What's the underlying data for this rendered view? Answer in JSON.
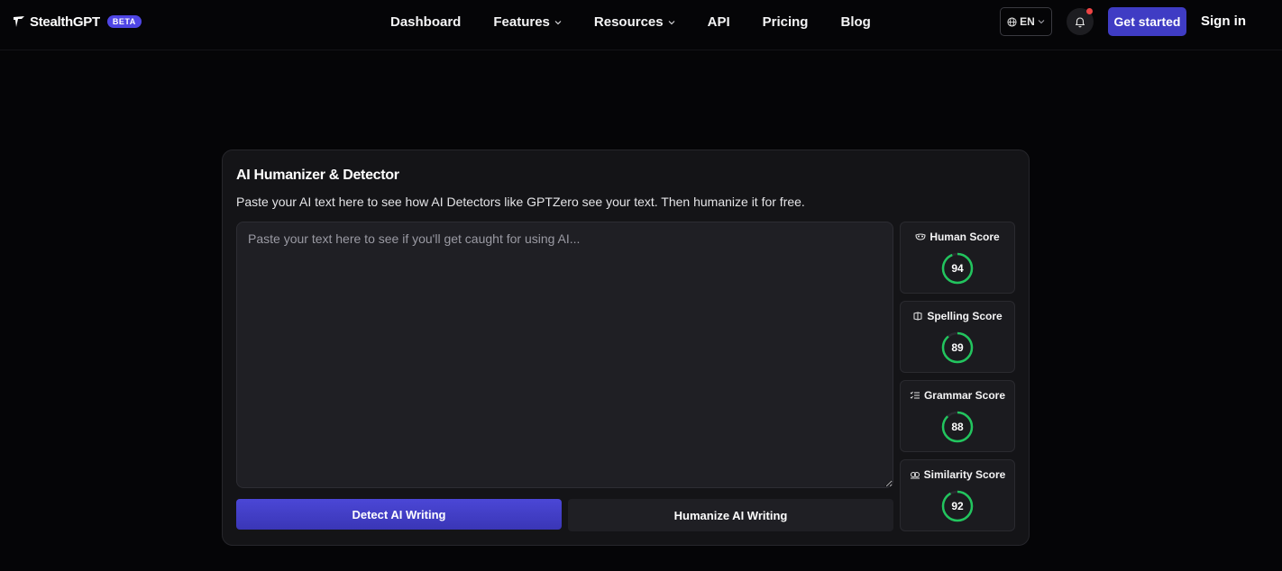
{
  "brand": {
    "name": "StealthGPT",
    "badge": "BETA"
  },
  "nav": {
    "links": [
      {
        "label": "Dashboard",
        "dropdown": false
      },
      {
        "label": "Features",
        "dropdown": true
      },
      {
        "label": "Resources",
        "dropdown": true
      },
      {
        "label": "API",
        "dropdown": false
      },
      {
        "label": "Pricing",
        "dropdown": false
      },
      {
        "label": "Blog",
        "dropdown": false
      }
    ],
    "language": "EN",
    "get_started": "Get started",
    "sign_in": "Sign in"
  },
  "card": {
    "title": "AI Humanizer & Detector",
    "subtitle": "Paste your AI text here to see how AI Detectors like GPTZero see your text. Then humanize it for free.",
    "input_placeholder": "Paste your text here to see if you'll get caught for using AI...",
    "input_value": "",
    "detect_label": "Detect AI Writing",
    "humanize_label": "Humanize AI Writing"
  },
  "scores": [
    {
      "label": "Human Score",
      "value": 94,
      "icon": "mask-icon"
    },
    {
      "label": "Spelling Score",
      "value": 89,
      "icon": "spelling-icon"
    },
    {
      "label": "Grammar Score",
      "value": 88,
      "icon": "grammar-icon"
    },
    {
      "label": "Similarity Score",
      "value": 92,
      "icon": "similarity-icon"
    }
  ],
  "colors": {
    "accent": "#3f3cc4",
    "score_ring": "#22c55e",
    "notification_dot": "#ef4444"
  }
}
